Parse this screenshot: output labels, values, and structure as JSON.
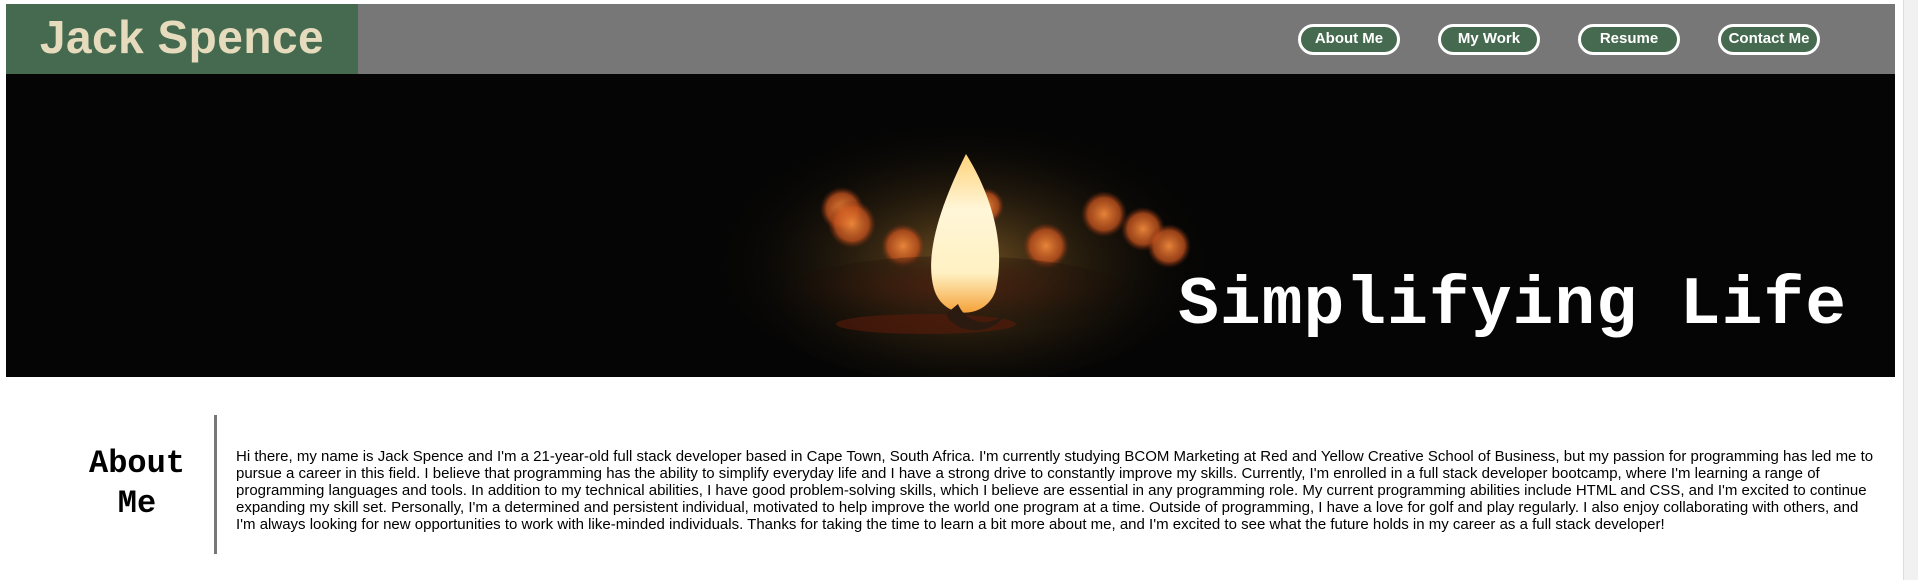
{
  "header": {
    "brand": "Jack Spence",
    "nav": [
      {
        "label": "About Me"
      },
      {
        "label": "My Work"
      },
      {
        "label": "Resume"
      },
      {
        "label": "Contact Me"
      }
    ]
  },
  "hero": {
    "tagline": "Simplifying Life",
    "image": "candle-flame-photo"
  },
  "about": {
    "heading_line1": "About",
    "heading_line2": "Me",
    "body": "Hi there, my name is Jack Spence and I'm a 21-year-old full stack developer based in Cape Town, South Africa. I'm currently studying BCOM Marketing at Red and Yellow Creative School of Business, but my passion for programming has led me to pursue a career in this field. I believe that programming has the ability to simplify everyday life and I have a strong drive to constantly improve my skills. Currently, I'm enrolled in a full stack developer bootcamp, where I'm learning a range of programming languages and tools. In addition to my technical abilities, I have good problem-solving skills, which I believe are essential in any programming role. My current programming abilities include HTML and CSS, and I'm excited to continue expanding my skill set. Personally, I'm a determined and persistent individual, motivated to help improve the world one program at a time. Outside of programming, I have a love for golf and play regularly. I also enjoy collaborating with others, and I'm always looking for new opportunities to work with like-minded individuals. Thanks for taking the time to learn a bit more about me, and I'm excited to see what the future holds in my career as a full stack developer!"
  },
  "colors": {
    "brand_green": "#466a4f",
    "header_gray": "#777777",
    "brand_text": "#e6dcbd"
  }
}
